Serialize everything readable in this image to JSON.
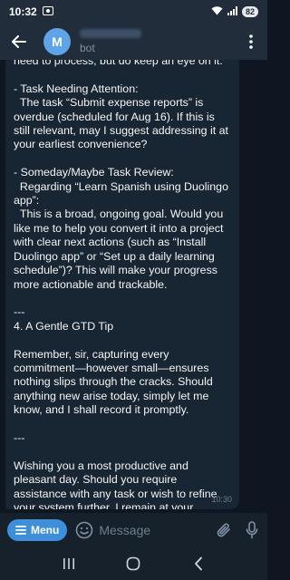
{
  "status_bar": {
    "time": "10:32",
    "battery": "82",
    "icons": [
      "screenshot-icon",
      "wifi-icon",
      "signal-icon"
    ]
  },
  "header": {
    "subtitle": "bot",
    "avatar_letter": "M",
    "accent_color": "#5fa3e8"
  },
  "message": {
    "text": "need to process, but do keep an eye on it.\n\n- Task Needing Attention:\n  The task “Submit expense reports” is overdue (scheduled for Aug 16). If this is still relevant, may I suggest addressing it at your earliest convenience?\n\n- Someday/Maybe Task Review:\n  Regarding “Learn Spanish using Duolingo app”:\n  This is a broad, ongoing goal. Would you like me to help you convert it into a project with clear next actions (such as “Install Duolingo app” or “Set up a daily learning schedule”)? This will make your progress more actionable and trackable.\n\n---\n4. A Gentle GTD Tip\n\nRemember, sir, capturing every commitment—however small—ensures nothing slips through the cracks. Should anything new arise today, simply let me know, and I shall record it promptly.\n\n---\n\nWishing you a most productive and pleasant day. Should you require assistance with any task or wish to refine your system further, I remain at your service.",
    "time": "10:30"
  },
  "input_bar": {
    "menu_label": "Menu",
    "placeholder": "Message"
  },
  "colors": {
    "background": "#0e1621",
    "bubble": "#182533",
    "header": "#212d3b",
    "menu_button": "#3e8fd9"
  }
}
